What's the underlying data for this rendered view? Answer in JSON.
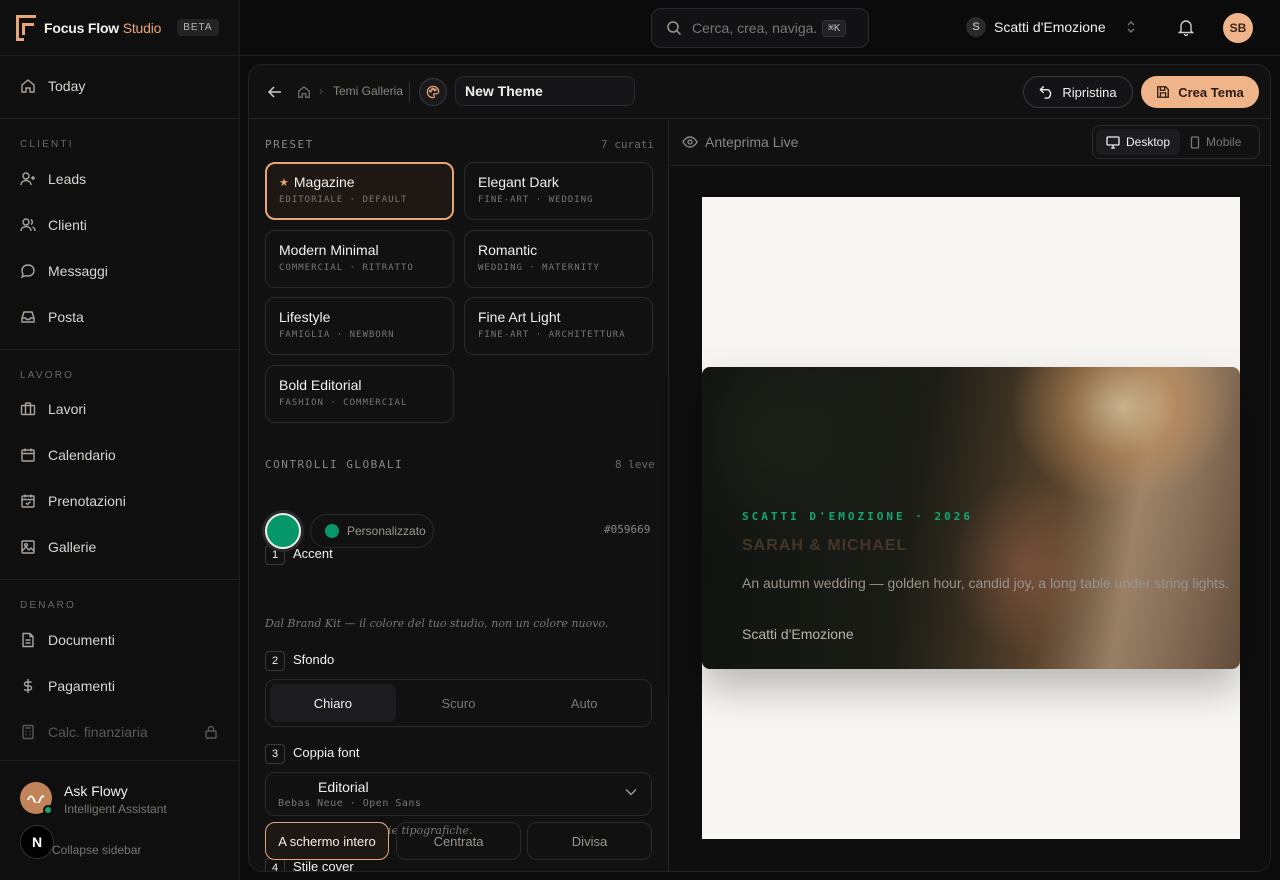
{
  "sidebar": {
    "brand": {
      "name": "Focus Flow",
      "name_suffix": "Studio",
      "badge": "BETA"
    },
    "today": "Today",
    "sections": {
      "clienti": "CLIENTI",
      "lavoro": "LAVORO",
      "denaro": "DENARO"
    },
    "items": {
      "leads": "Leads",
      "clienti": "Clienti",
      "messaggi": "Messaggi",
      "posta": "Posta",
      "lavori": "Lavori",
      "calendario": "Calendario",
      "prenotazioni": "Prenotazioni",
      "gallerie": "Gallerie",
      "documenti": "Documenti",
      "pagamenti": "Pagamenti",
      "calc": "Calc. finanziaria"
    },
    "assistant": {
      "name": "Ask Flowy",
      "subtitle": "Intelligent Assistant"
    },
    "n_badge": "N",
    "collapse": "Collapse sidebar"
  },
  "topbar": {
    "search_placeholder": "Cerca, crea, naviga...",
    "shortcut": "⌘K",
    "studio_initial": "S",
    "studio_name": "Scatti d'Emozione",
    "user_initials": "SB"
  },
  "header": {
    "breadcrumb": "Temi Galleria",
    "theme_name": "New Theme",
    "reset_label": "Ripristina",
    "create_label": "Crea Tema"
  },
  "presets": {
    "label": "PRESET",
    "count": "7 curati",
    "items": [
      {
        "name": "Magazine",
        "tags": "EDITORIALE · DEFAULT"
      },
      {
        "name": "Elegant Dark",
        "tags": "FINE-ART · WEDDING"
      },
      {
        "name": "Modern Minimal",
        "tags": "COMMERCIAL · RITRATTO"
      },
      {
        "name": "Romantic",
        "tags": "WEDDING · MATERNITY"
      },
      {
        "name": "Lifestyle",
        "tags": "FAMIGLIA · NEWBORN"
      },
      {
        "name": "Fine Art Light",
        "tags": "FINE-ART · ARCHITETTURA"
      },
      {
        "name": "Bold Editorial",
        "tags": "FASHION · COMMERCIAL"
      }
    ]
  },
  "controls": {
    "label": "CONTROLLI GLOBALI",
    "count": "8 leve",
    "accent": {
      "num": "1",
      "title": "Accent",
      "custom_label": "Personalizzato",
      "hex": "#059669",
      "hint": "Dal Brand Kit — il colore del tuo studio, non un colore nuovo.",
      "color": "#059669"
    },
    "background": {
      "num": "2",
      "title": "Sfondo",
      "options": [
        "Chiaro",
        "Scuro",
        "Auto"
      ],
      "selected": "Chiaro"
    },
    "font": {
      "num": "3",
      "title": "Coppia font",
      "selected": "Editorial",
      "pair": "Bebas Neue · Open Sans",
      "hint": "Dal set curato di coppie tipografiche."
    },
    "cover": {
      "num": "4",
      "title": "Stile cover",
      "options": [
        "A schermo intero",
        "Centrata",
        "Divisa"
      ],
      "selected": "A schermo intero"
    }
  },
  "preview": {
    "title": "Anteprima Live",
    "devices": [
      "Desktop",
      "Mobile"
    ],
    "selected_device": "Desktop",
    "hero": {
      "kicker": "SCATTI D'EMOZIONE · 2026",
      "title": "SARAH & MICHAEL",
      "description": "An autumn wedding — golden hour, candid joy, a long table under string lights.",
      "studio": "Scatti d'Emozione"
    }
  },
  "colors": {
    "accent_brand": "#e8a57a",
    "accent_theme": "#059669",
    "background": "#0b0b0c"
  }
}
